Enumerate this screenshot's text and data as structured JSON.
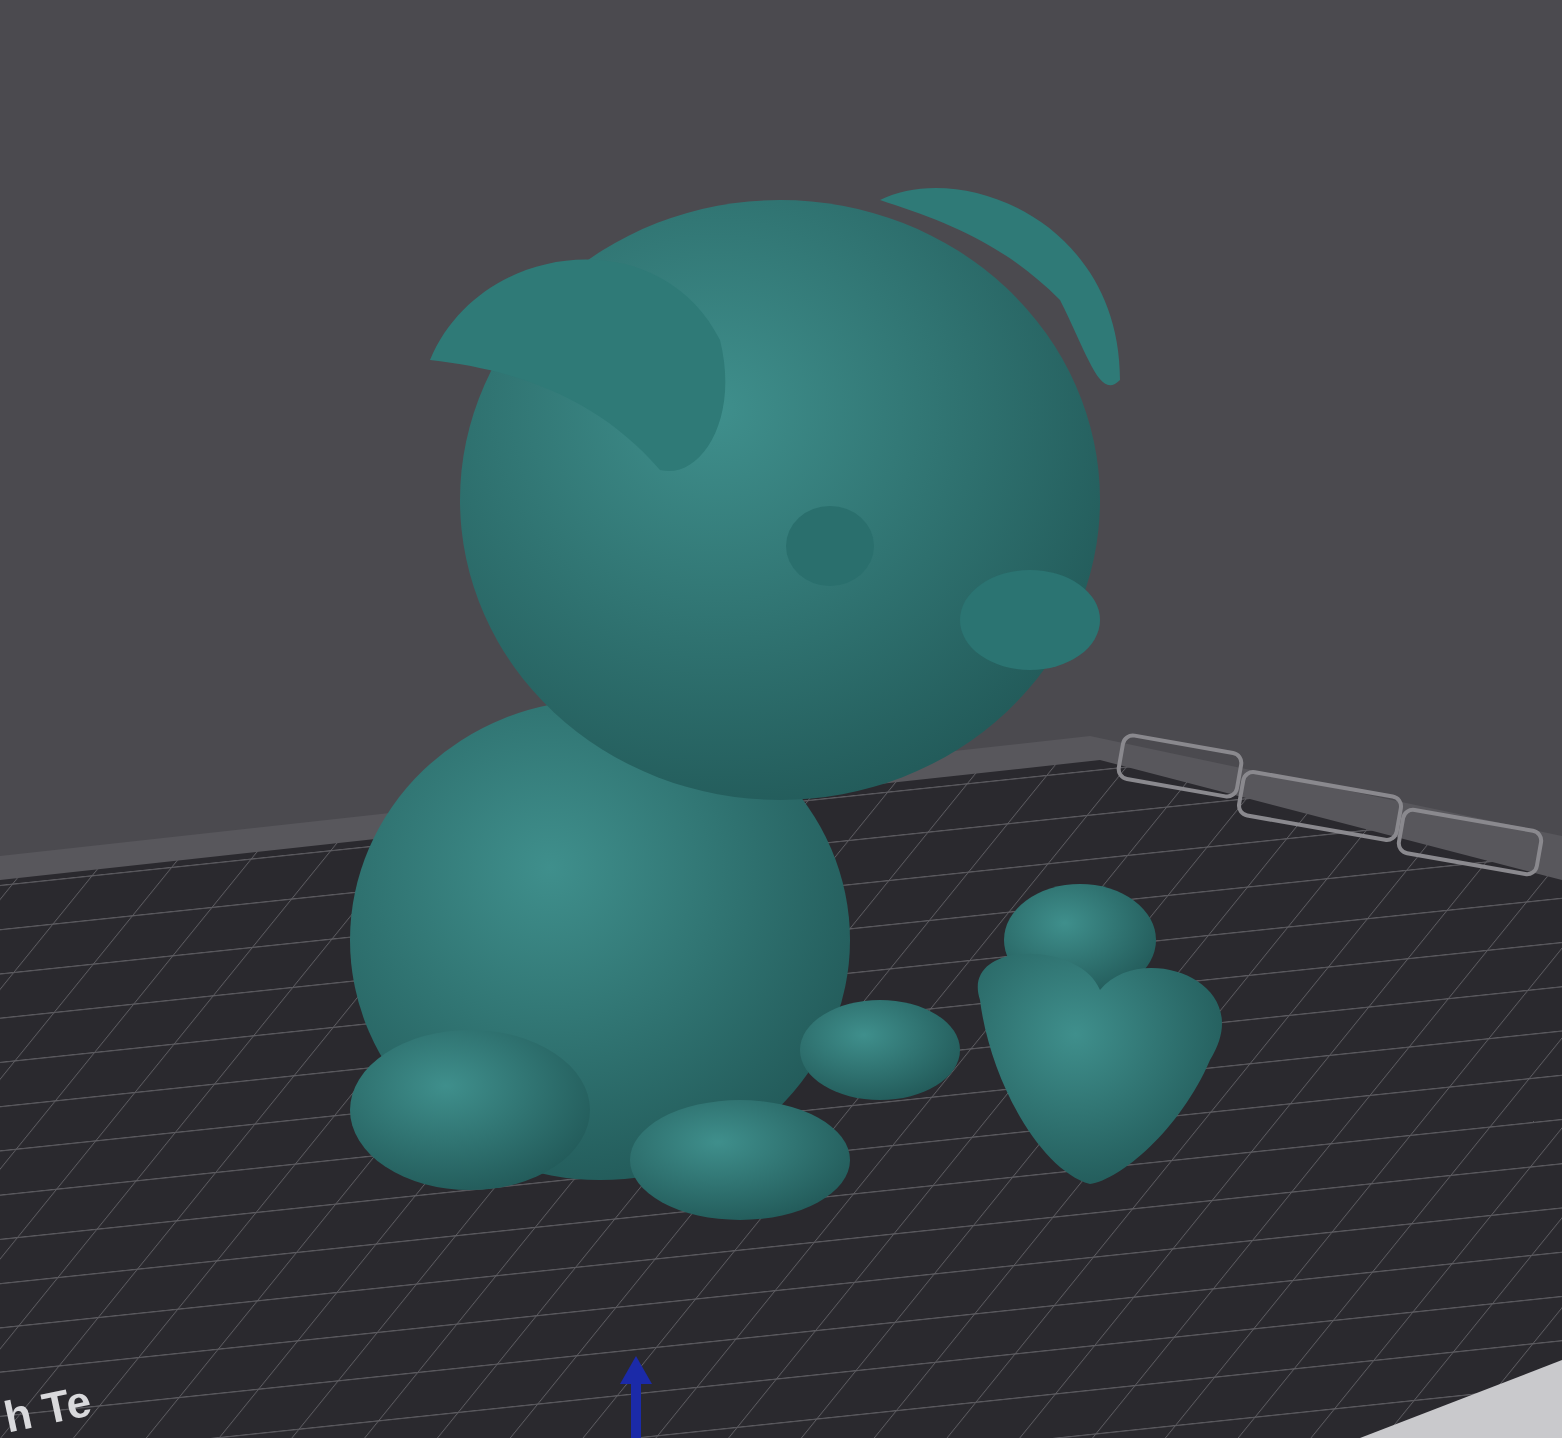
{
  "plate_label": "h Te"
}
